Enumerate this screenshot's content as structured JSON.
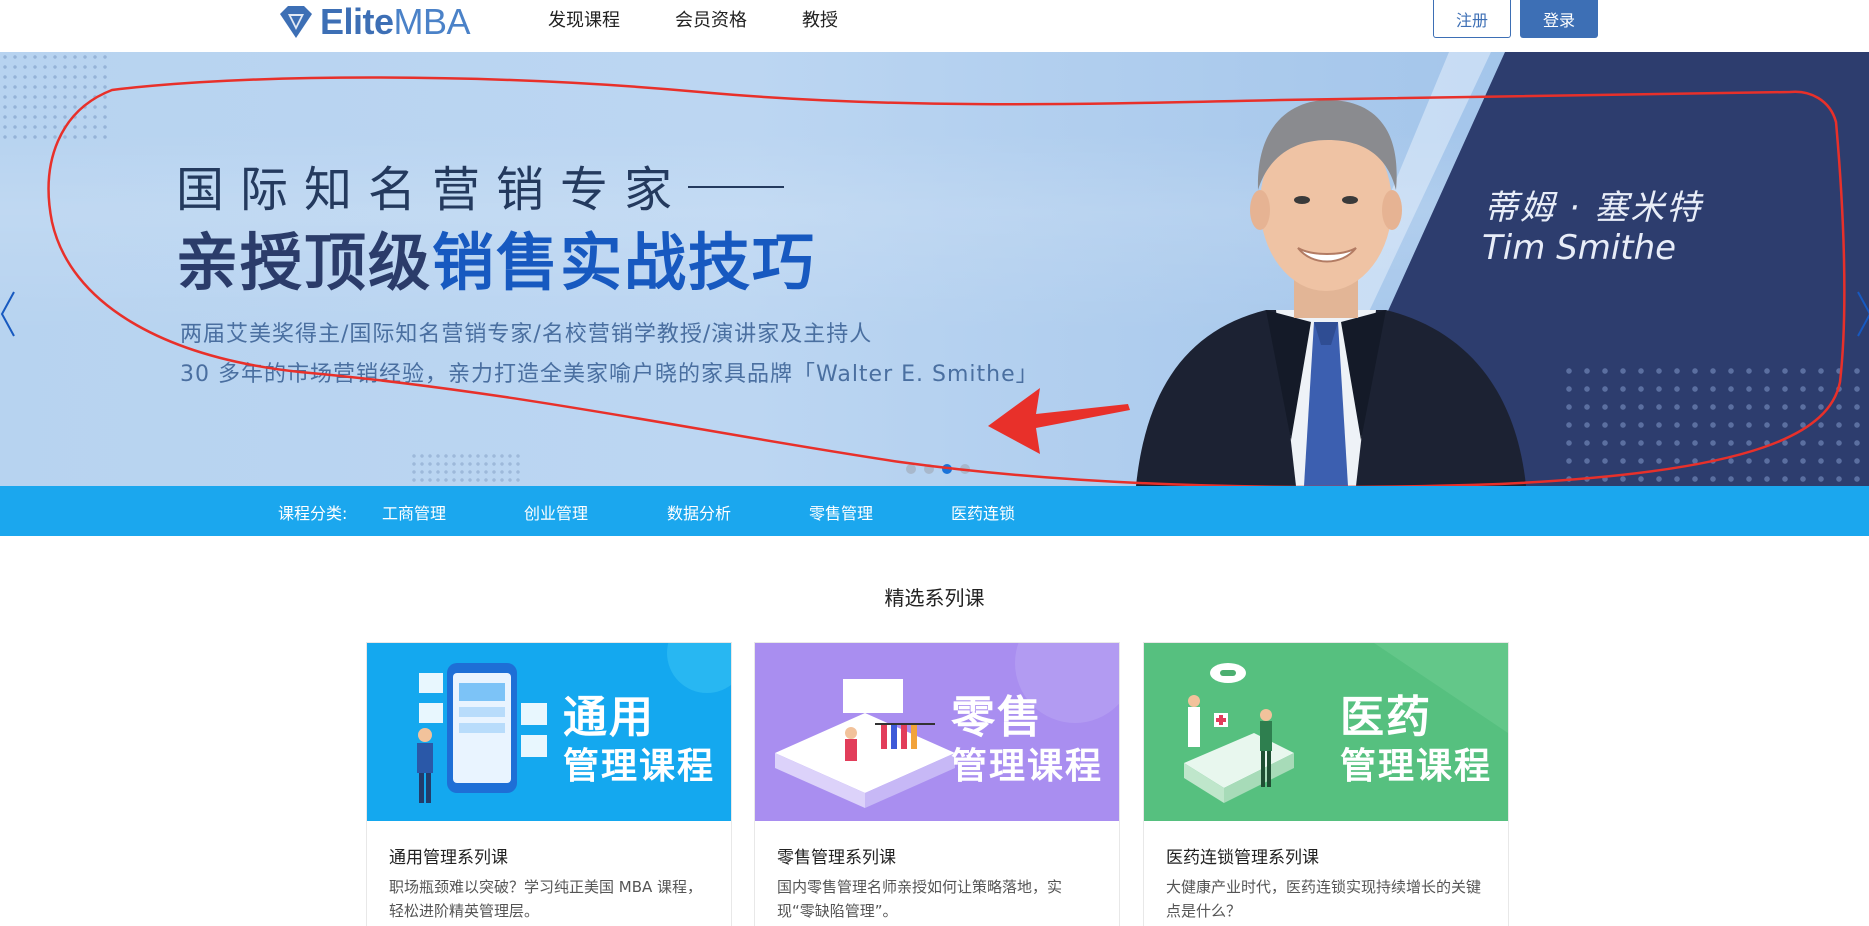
{
  "header": {
    "logo": {
      "elite": "Elite",
      "mba": "MBA"
    },
    "nav": [
      "发现课程",
      "会员资格",
      "教授"
    ],
    "register_label": "注册",
    "login_label": "登录",
    "brand_color": "#3d6fb5"
  },
  "hero": {
    "line1": "国际知名营销专家",
    "line2_plain": "亲授顶级",
    "line2_highlight": "销售实战技巧",
    "desc1": "两届艾美奖得主/国际知名营销专家/名校营销学教授/演讲家及主持人",
    "desc2": "30 多年的市场营销经验，亲力打造全美家喻户晓的家具品牌「Walter E. Smithe」",
    "name_cn": "蒂姆 · 塞米特",
    "name_en": "Tim Smithe",
    "carousel_active_index": 2,
    "carousel_count": 4
  },
  "categories": {
    "label": "课程分类:",
    "items": [
      "工商管理",
      "创业管理",
      "数据分析",
      "零售管理",
      "医药连锁"
    ]
  },
  "featured": {
    "title": "精选系列课",
    "cards": [
      {
        "img_line1": "通用",
        "img_line2": "管理课程",
        "title": "通用管理系列课",
        "desc": "职场瓶颈难以突破？学习纯正美国 MBA 课程，轻松进阶精英管理层。",
        "color": "#14a8ef"
      },
      {
        "img_line1": "零售",
        "img_line2": "管理课程",
        "title": "零售管理系列课",
        "desc": "国内零售管理名师亲授如何让策略落地，实现“零缺陷管理”。",
        "color": "#a98ef0"
      },
      {
        "img_line1": "医药",
        "img_line2": "管理课程",
        "title": "医药连锁管理系列课",
        "desc": "大健康产业时代，医药连锁实现持续增长的关键点是什么？",
        "color": "#56c07f"
      }
    ]
  }
}
